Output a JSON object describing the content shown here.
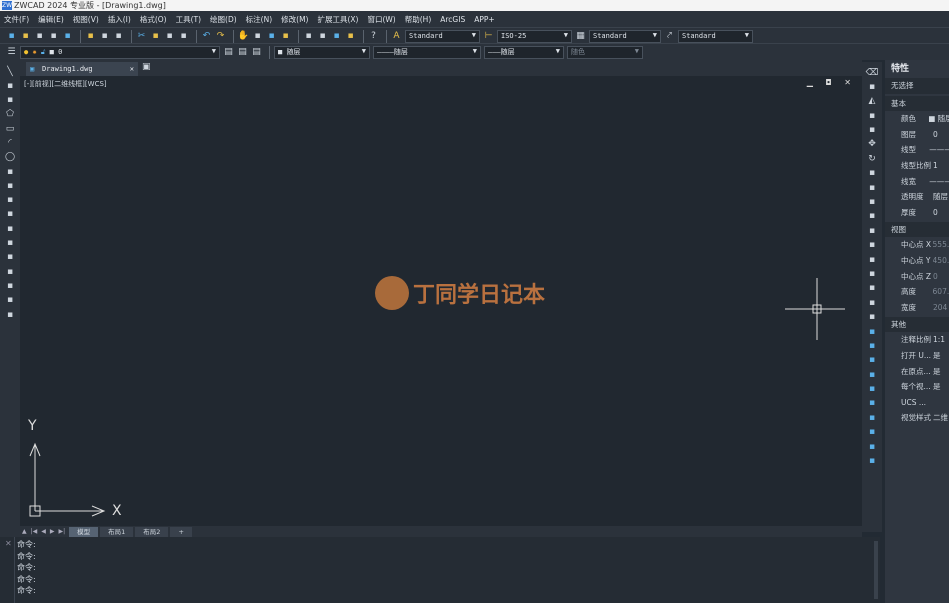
{
  "title": {
    "logo": "ZW",
    "text": "ZWCAD 2024 专业版 - [Drawing1.dwg]"
  },
  "menu": [
    "文件(F)",
    "编辑(E)",
    "视图(V)",
    "插入(I)",
    "格式(O)",
    "工具(T)",
    "绘图(D)",
    "标注(N)",
    "修改(M)",
    "扩展工具(X)",
    "窗口(W)",
    "帮助(H)",
    "ArcGIS",
    "APP+"
  ],
  "toolbar1": {
    "icons": [
      "new-icon",
      "open-icon",
      "save-icon",
      "save-as-icon",
      "publish-icon",
      "print-icon",
      "plot-preview-icon",
      "plot-icon",
      "cut-icon",
      "copy-icon",
      "paste-icon",
      "match-properties-icon",
      "undo-icon",
      "redo-icon",
      "pan-icon",
      "zoom-realtime-icon",
      "zoom-window-icon",
      "zoom-previous-icon",
      "properties-icon",
      "design-center-icon",
      "tool-palette-icon",
      "markup-icon",
      "help-icon"
    ],
    "text_style": "Standard",
    "dim_style": "ISO-25",
    "table_style": "Standard",
    "multileader_style": "Standard"
  },
  "toolbar2": {
    "layer": "0",
    "color": "随层",
    "linetype": "随层",
    "lineweight": "随层",
    "plotstyle": "随色"
  },
  "tab": {
    "name": "Drawing1.dwg"
  },
  "viewport": {
    "label": "[-][前视][二维线框][WCS]",
    "controls": "▁ ◘ ✕",
    "watermark": "丁同学日记本",
    "ucs_x": "X",
    "ucs_y": "Y"
  },
  "layouts": {
    "nav": [
      "▲",
      "|◀",
      "◀",
      "▶",
      "▶|"
    ],
    "tabs": [
      "模型",
      "布局1",
      "布局2",
      "+"
    ]
  },
  "command": {
    "lines": [
      "命令:",
      "命令:",
      "命令:",
      "命令:",
      "命令:"
    ]
  },
  "left_tools": [
    "line-icon",
    "construction-line-icon",
    "polyline-icon",
    "polygon-icon",
    "rectangle-icon",
    "arc-icon",
    "circle-icon",
    "revision-cloud-icon",
    "spline-icon",
    "ellipse-icon",
    "ellipse-arc-icon",
    "insert-block-icon",
    "make-block-icon",
    "point-icon",
    "hatch-icon",
    "region-icon",
    "table-icon",
    "mtext-icon"
  ],
  "right_tools": [
    "erase-icon",
    "copy-object-icon",
    "mirror-icon",
    "offset-icon",
    "array-icon",
    "move-icon",
    "rotate-icon",
    "scale-icon",
    "stretch-icon",
    "trim-icon",
    "extend-icon",
    "break-point-icon",
    "break-icon",
    "join-icon",
    "chamfer-icon",
    "fillet-icon",
    "blend-icon",
    "explode-icon",
    "draw-order-icon",
    "bring-front-icon",
    "send-back-icon",
    "bring-above-icon",
    "send-under-icon",
    "text-front-icon",
    "dim-front-icon",
    "leader-front-icon",
    "all-front-icon",
    "hatch-back-icon"
  ],
  "properties": {
    "title": "特性",
    "selection": "无选择",
    "sections": [
      {
        "name": "基本",
        "rows": [
          {
            "k": "颜色",
            "v": "■ 随层"
          },
          {
            "k": "图层",
            "v": "0"
          },
          {
            "k": "线型",
            "v": "———"
          },
          {
            "k": "线型比例",
            "v": "1"
          },
          {
            "k": "线宽",
            "v": "———"
          },
          {
            "k": "透明度",
            "v": "随层"
          },
          {
            "k": "厚度",
            "v": "0"
          }
        ]
      },
      {
        "name": "视图",
        "rows": [
          {
            "k": "中心点 X",
            "v": "555.",
            "dim": true
          },
          {
            "k": "中心点 Y",
            "v": "450.",
            "dim": true
          },
          {
            "k": "中心点 Z",
            "v": "0",
            "dim": true
          },
          {
            "k": "高度",
            "v": "607.",
            "dim": true
          },
          {
            "k": "宽度",
            "v": "204",
            "dim": true
          }
        ]
      },
      {
        "name": "其他",
        "rows": [
          {
            "k": "注释比例",
            "v": "1:1"
          },
          {
            "k": "打开 U...",
            "v": "是"
          },
          {
            "k": "在原点...",
            "v": "是"
          },
          {
            "k": "每个视...",
            "v": "是"
          },
          {
            "k": "UCS ...",
            "v": ""
          },
          {
            "k": "视觉样式",
            "v": "二维"
          }
        ]
      }
    ]
  }
}
